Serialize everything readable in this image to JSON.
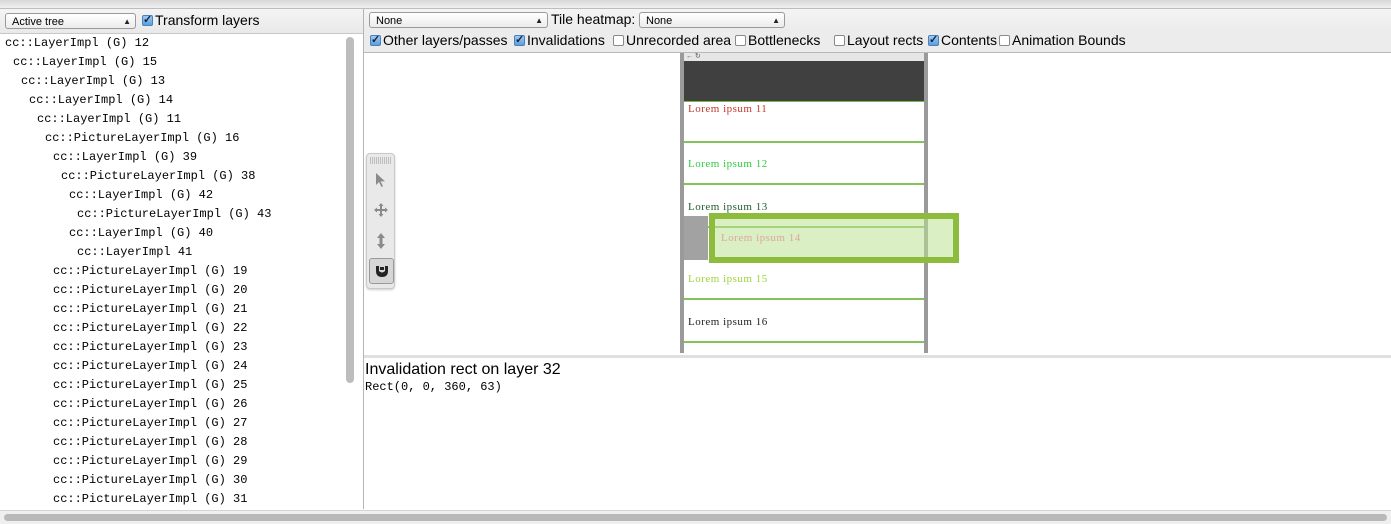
{
  "left_toolbar": {
    "tree_select": "Active tree",
    "transform_layers_label": "Transform layers",
    "transform_layers_checked": true
  },
  "tree": [
    {
      "text": "cc::LayerImpl (G) 12",
      "indent": 0,
      "color": "#000000"
    },
    {
      "text": "cc::LayerImpl (G) 15",
      "indent": 1,
      "color": "#000000"
    },
    {
      "text": "cc::LayerImpl (G) 13",
      "indent": 2,
      "color": "#000000"
    },
    {
      "text": "cc::LayerImpl (G) 14",
      "indent": 3,
      "color": "#000000"
    },
    {
      "text": "cc::LayerImpl (G) 11",
      "indent": 4,
      "color": "#000000"
    },
    {
      "text": "cc::PictureLayerImpl (G) 16",
      "indent": 5,
      "color": "#000000"
    },
    {
      "text": "cc::LayerImpl (G) 39",
      "indent": 6,
      "color": "#000000"
    },
    {
      "text": "cc::PictureLayerImpl (G) 38",
      "indent": 7,
      "color": "#000000"
    },
    {
      "text": "cc::LayerImpl (G) 42",
      "indent": 8,
      "color": "#000000"
    },
    {
      "text": "cc::PictureLayerImpl (G) 43",
      "indent": 9,
      "color": "#000000"
    },
    {
      "text": "cc::LayerImpl (G) 40",
      "indent": 8,
      "color": "#000000"
    },
    {
      "text": "cc::LayerImpl 41",
      "indent": 9,
      "color": "#000000"
    },
    {
      "text": "cc::PictureLayerImpl (G) 19",
      "indent": 6,
      "color": "#000000"
    },
    {
      "text": "cc::PictureLayerImpl (G) 20",
      "indent": 6,
      "color": "#000000"
    },
    {
      "text": "cc::PictureLayerImpl (G) 21",
      "indent": 6,
      "color": "#000000"
    },
    {
      "text": "cc::PictureLayerImpl (G) 22",
      "indent": 6,
      "color": "#000000"
    },
    {
      "text": "cc::PictureLayerImpl (G) 23",
      "indent": 6,
      "color": "#000000"
    },
    {
      "text": "cc::PictureLayerImpl (G) 24",
      "indent": 6,
      "color": "#000000"
    },
    {
      "text": "cc::PictureLayerImpl (G) 25",
      "indent": 6,
      "color": "#000000"
    },
    {
      "text": "cc::PictureLayerImpl (G) 26",
      "indent": 6,
      "color": "#000000"
    },
    {
      "text": "cc::PictureLayerImpl (G) 27",
      "indent": 6,
      "color": "#000000"
    },
    {
      "text": "cc::PictureLayerImpl (G) 28",
      "indent": 6,
      "color": "#000000"
    },
    {
      "text": "cc::PictureLayerImpl (G) 29",
      "indent": 6,
      "color": "#000000"
    },
    {
      "text": "cc::PictureLayerImpl (G) 30",
      "indent": 6,
      "color": "#000000"
    },
    {
      "text": "cc::PictureLayerImpl (G) 31",
      "indent": 6,
      "color": "#000000"
    }
  ],
  "right_toolbar": {
    "overlay_select": "None",
    "tile_heatmap_label": "Tile heatmap:",
    "tile_heatmap_select": "None",
    "options": [
      {
        "label": "Other layers/passes",
        "checked": true
      },
      {
        "label": "Invalidations",
        "checked": true
      },
      {
        "label": "Unrecorded area",
        "checked": false
      },
      {
        "label": "Bottlenecks",
        "checked": false
      },
      {
        "label": "Layout rects",
        "checked": false
      },
      {
        "label": "Contents",
        "checked": true
      },
      {
        "label": "Animation Bounds",
        "checked": false
      }
    ]
  },
  "preview": {
    "items": [
      {
        "text": "Lorem ipsum 11",
        "color": "#c0392b"
      },
      {
        "text": "Lorem ipsum 12",
        "color": "#2ecc40"
      },
      {
        "text": "Lorem ipsum 13",
        "color": "#1e5e2a"
      },
      {
        "text": "Lorem ipsum 14",
        "color": "#d9a89e"
      },
      {
        "text": "Lorem ipsum 15",
        "color": "#9bd43a"
      },
      {
        "text": "Lorem ipsum 16",
        "color": "#222222"
      }
    ],
    "highlight_color": "#8dbb3c"
  },
  "invalidation": {
    "title": "Invalidation rect on layer 32",
    "rect": "Rect(0, 0, 360, 63)"
  },
  "tools": [
    {
      "name": "select-tool",
      "icon": "arrow-pointer-icon",
      "active": false
    },
    {
      "name": "pan-tool",
      "icon": "move-icon",
      "active": false
    },
    {
      "name": "zoom-tool",
      "icon": "vertical-resize-icon",
      "active": false
    },
    {
      "name": "rotate-tool",
      "icon": "gamepad-icon",
      "active": true
    }
  ]
}
